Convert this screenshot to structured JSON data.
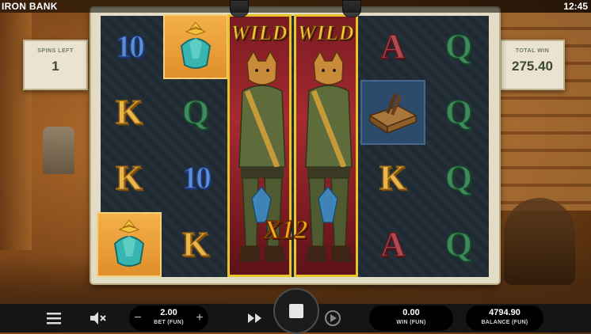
{
  "header": {
    "title": "IRON BANK",
    "clock": "12:45"
  },
  "panels": {
    "spins_left": {
      "label": "SPINS LEFT",
      "value": "1"
    },
    "total_win": {
      "label": "TOTAL WIN",
      "value": "275.40"
    }
  },
  "reels": {
    "wild_label": "WILD",
    "multiplier": "X12",
    "columns": [
      [
        "10",
        "K",
        "K",
        "gem"
      ],
      [
        "gem",
        "Q",
        "10",
        "K"
      ],
      [
        "WILD",
        "WILD",
        "WILD",
        "WILD"
      ],
      [
        "WILD",
        "WILD",
        "WILD",
        "WILD"
      ],
      [
        "A",
        "cigar-box",
        "K",
        "A"
      ],
      [
        "Q",
        "Q",
        "Q",
        "Q"
      ]
    ]
  },
  "bottom_bar": {
    "bet": {
      "value": "2.00",
      "label": "BET (FUN)"
    },
    "win": {
      "value": "0.00",
      "label": "WIN (FUN)"
    },
    "balance": {
      "value": "4794.90",
      "label": "BALANCE (FUN)"
    },
    "icons": [
      "menu-icon",
      "sound-muted-icon",
      "minus-icon",
      "plus-icon",
      "fast-forward-icon",
      "stop-icon",
      "autoplay-icon"
    ]
  },
  "colors": {
    "wild_border": "#e8c42a",
    "frame": "#e2dcc6",
    "reel_bg": "#1f2a33",
    "accent_gold": "#f3c53a"
  }
}
